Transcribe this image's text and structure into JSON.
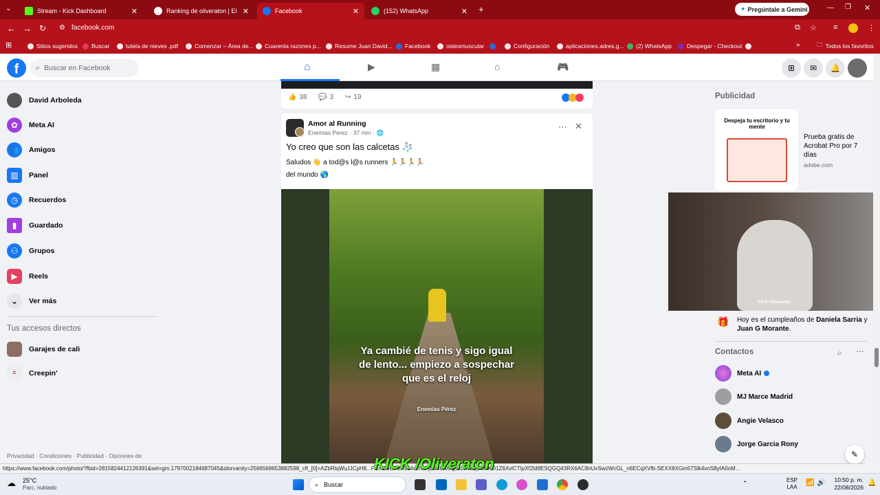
{
  "browser": {
    "tabs": [
      {
        "label": "Stream - Kick Dashboard",
        "color": "#53fc18"
      },
      {
        "label": "Ranking de oliveraton | El mejo",
        "color": "#fff"
      },
      {
        "label": "Facebook",
        "color": "#1877f2"
      },
      {
        "label": "(152) WhatsApp",
        "color": "#25d366"
      }
    ],
    "gemini_button": "Pregúntale a Gemini",
    "url": "facebook.com",
    "bookmarks": [
      "Sitios sugeridos",
      "Buscar",
      "tutela de nieves .pdf",
      "Comenzar – Área de...",
      "Cuarenta razones p...",
      "Resume Juan David...",
      "Facebook",
      "osteomuscular",
      "Configuración",
      "aplicaciones.adres.g...",
      "(2) WhatsApp",
      "Despegar - Checkout"
    ],
    "all_favorites": "Todos los favoritos"
  },
  "fb": {
    "search_placeholder": "Buscar en Facebook",
    "nav": [
      {
        "label": "David Arboleda",
        "color": "#555"
      },
      {
        "label": "Meta AI",
        "color": "#a03ee0"
      },
      {
        "label": "Amigos",
        "color": "#1877f2"
      },
      {
        "label": "Panel",
        "color": "#1877f2"
      },
      {
        "label": "Recuerdos",
        "color": "#1877f2"
      },
      {
        "label": "Guardado",
        "color": "#a03ee0"
      },
      {
        "label": "Grupos",
        "color": "#1877f2"
      },
      {
        "label": "Reels",
        "color": "#e4405f"
      },
      {
        "label": "Ver más",
        "color": "#e4e6eb"
      }
    ],
    "shortcuts_title": "Tus accesos directos",
    "shortcuts": [
      "Garajes de cali",
      "Creepin'"
    ],
    "footer": "Privacidad · Condiciones · Publicidad · Opciones de",
    "prev_post": {
      "likes": "38",
      "comments": "3",
      "shares": "19"
    },
    "post": {
      "group": "Amor al Running",
      "author": "Enemias Perez",
      "time": "· 37 min ·",
      "title": "Yo creo que son las calcetas 🧦",
      "body_line1": "Saludos 👋 a tod@s l@s runners 🏃🏃🏃🏃",
      "body_line2": "del mundo 🌎",
      "video_caption": "Ya cambié de tenis y sigo igual de lento... empiezo a sospechar que es el reloj",
      "video_author": "Enemias Pérez"
    },
    "ads": {
      "title": "Publicidad",
      "ad_image_text": "Despeja tu escritorio y tu mente",
      "ad_headline": "Prueba gratis de Acrobat Pro por 7 días",
      "ad_domain": "adobe.com"
    },
    "birthday_prefix": "Hoy es el cumpleaños de ",
    "birthday_name1": "Daniela Sarria",
    "birthday_mid": " y ",
    "birthday_name2": "Juan G Morante",
    "birthday_suffix": ".",
    "contacts_title": "Contactos",
    "contacts": [
      "Meta AI",
      "MJ Marce Madrid",
      "Angie Velasco",
      "Jorge Garcia Rony"
    ]
  },
  "stream": {
    "overlay": "KICK /Oliveraton",
    "cam_label": "KICK /Oliveraton"
  },
  "status_url": "https://www.facebook.com/photo/?fbid=2815824412126391&set=gm.1797002184687045&idorvanity=2566568653882598_cft_[0]=AZbRlqWuJJCpH8...FCmZetsFu7S64vchaPjzJmW99Qzs0kYa5j6f0uKO1Z6XvlCTIpXf2ld9ESQGQ43RX6AC8nUvSwzWcGL_n6ECqXVfb-SEXX8XGm57Slk4xnS8yIA0oM...",
  "taskbar": {
    "weather_temp": "25°C",
    "weather_desc": "Parc. nublado",
    "search_label": "Buscar",
    "lang1": "ESP",
    "lang2": "LAA",
    "time": "10:50 p. m.",
    "date": "22/08/2026"
  }
}
